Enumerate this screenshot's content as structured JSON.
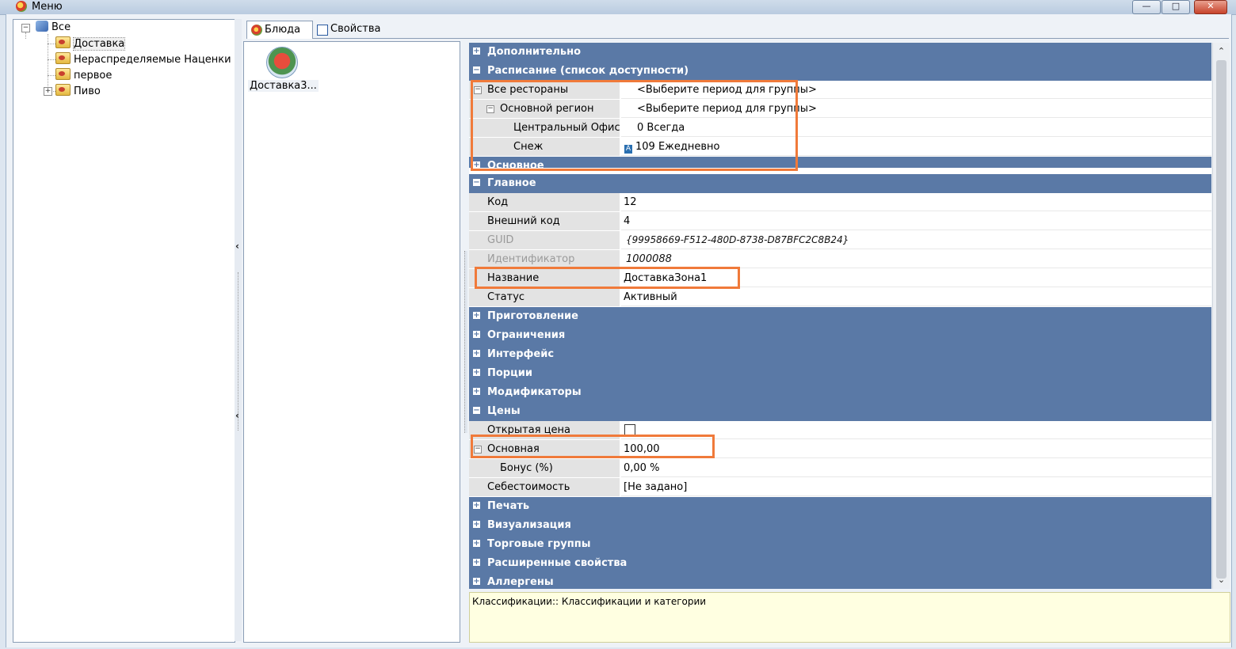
{
  "window": {
    "title": "Меню",
    "controls": [
      "minimize",
      "maximize",
      "close"
    ]
  },
  "tree": {
    "root": "Все",
    "items": [
      {
        "label": "Доставка",
        "selected": true
      },
      {
        "label": "Нераспределяемые Наценки"
      },
      {
        "label": "первое"
      },
      {
        "label": "Пиво",
        "expandable": true
      }
    ]
  },
  "tabs": [
    {
      "label": "Блюда",
      "active": true
    },
    {
      "label": "Свойства"
    }
  ],
  "dish_list": [
    {
      "label": "Доставка3..."
    }
  ],
  "property_grid": {
    "cat_additional": "Дополнительно",
    "cat_schedule": "Расписание (список доступности)",
    "all_restaurants": {
      "name": "Все рестораны",
      "value": "<Выберите период для группы>"
    },
    "main_region": {
      "name": "Основной регион",
      "value": "<Выберите период для группы>"
    },
    "central_office": {
      "name": "Центральный Офис",
      "value": "0 Всегда"
    },
    "snow": {
      "name": "Снеж",
      "value": "109 Ежедневно"
    },
    "cat_basic": "Основное",
    "cat_main": "Главное",
    "code": {
      "name": "Код",
      "value": "12"
    },
    "ext_code": {
      "name": "Внешний код",
      "value": "4"
    },
    "guid": {
      "name": "GUID",
      "value": "{99958669-F512-480D-8738-D87BFC2C8B24}"
    },
    "ident": {
      "name": "Идентификатор",
      "value": "1000088"
    },
    "title": {
      "name": "Название",
      "value": "ДоставкаЗона1"
    },
    "status": {
      "name": "Статус",
      "value": "Активный"
    },
    "cat_prep": "Приготовление",
    "cat_limits": "Ограничения",
    "cat_iface": "Интерфейс",
    "cat_portions": "Порции",
    "cat_mods": "Модификаторы",
    "cat_prices": "Цены",
    "open_price": {
      "name": "Открытая цена",
      "checked": false
    },
    "base_price": {
      "name": "Основная",
      "value": "100,00"
    },
    "bonus": {
      "name": "Бонус (%)",
      "value": "0,00 %"
    },
    "cost": {
      "name": "Себестоимость",
      "value": "[Не задано]"
    },
    "cat_print": "Печать",
    "cat_visual": "Визуализация",
    "cat_trade": "Торговые группы",
    "cat_ext": "Расширенные свойства",
    "cat_allergens": "Аллергены"
  },
  "description": "Классификации:: Классификации и категории",
  "colors": {
    "category_header": "#5a79a6",
    "highlight": "#f07a3a",
    "description_bg": "#ffffe1"
  }
}
